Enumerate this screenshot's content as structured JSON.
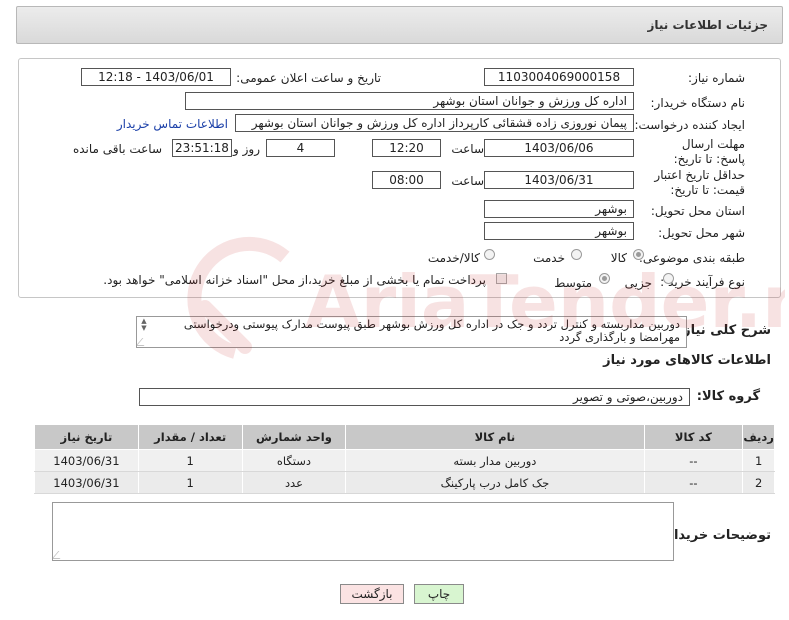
{
  "page_title": "جزئیات اطلاعات نیاز",
  "fields": {
    "need_number_label": "شماره نیاز:",
    "need_number": "1103004069000158",
    "announce_label": "تاریخ و ساعت اعلان عمومی:",
    "announce_value": "1403/06/01 - 12:18",
    "buyer_org_label": "نام دستگاه خریدار:",
    "buyer_org": "اداره کل ورزش و جوانان استان بوشهر",
    "requester_label": "ایجاد کننده درخواست:",
    "requester": "پیمان نوروزی زاده قشقائی کارپرداز اداره کل ورزش و جوانان استان بوشهر",
    "buyer_contact_link": "اطلاعات تماس خریدار",
    "reply_deadline_label": "مهلت ارسال پاسخ: تا تاریخ:",
    "reply_date": "1403/06/06",
    "time_label": "ساعت",
    "reply_time": "12:20",
    "days_value": "4",
    "days_label": "روز و",
    "remaining_time": "23:51:18",
    "remaining_label": "ساعت باقی مانده",
    "price_validity_label": "حداقل تاریخ اعتبار قیمت: تا تاریخ:",
    "price_date": "1403/06/31",
    "price_time_label": "ساعت",
    "price_time": "08:00",
    "province_label": "استان محل تحویل:",
    "province": "بوشهر",
    "city_label": "شهر محل تحویل:",
    "city": "بوشهر",
    "category_label": "طبقه بندی موضوعی:",
    "category_options": [
      "کالا",
      "خدمت",
      "کالا/خدمت"
    ],
    "process_label": "نوع فرآیند خرید :",
    "process_options": [
      "جزیی",
      "متوسط"
    ],
    "payment_note": "پرداخت تمام یا بخشی از مبلغ خرید،از محل \"اسناد خزانه اسلامی\" خواهد بود."
  },
  "description": {
    "label": "شرح کلی نیاز:",
    "text": "دوربین مداربسته و کنترل تردد و جک در اداره کل ورزش بوشهر طبق پیوست مدارک پیوستی ودرخواستی مهرامضا و بارگذاری گردد"
  },
  "goods_section": {
    "title": "اطلاعات کالاهای مورد نیاز",
    "group_label": "گروه کالا:",
    "group_value": "دوربین،صوتی و تصویر"
  },
  "table": {
    "headers": [
      "ردیف",
      "کد کالا",
      "نام کالا",
      "واحد شمارش",
      "تعداد / مقدار",
      "تاریخ نیاز"
    ],
    "rows": [
      [
        "1",
        "--",
        "دوربین مدار بسته",
        "دستگاه",
        "1",
        "1403/06/31"
      ],
      [
        "2",
        "--",
        "جک کامل درب پارکینگ",
        "عدد",
        "1",
        "1403/06/31"
      ]
    ]
  },
  "buyer_notes_label": "توضیحات خریدار:",
  "buttons": {
    "print": "چاپ",
    "back": "بازگشت"
  },
  "watermark_text": "AriaTender.net",
  "colors": {
    "print_bg": "#d8f5d0",
    "back_bg": "#fbe3e3",
    "watermark": "#c62828"
  }
}
